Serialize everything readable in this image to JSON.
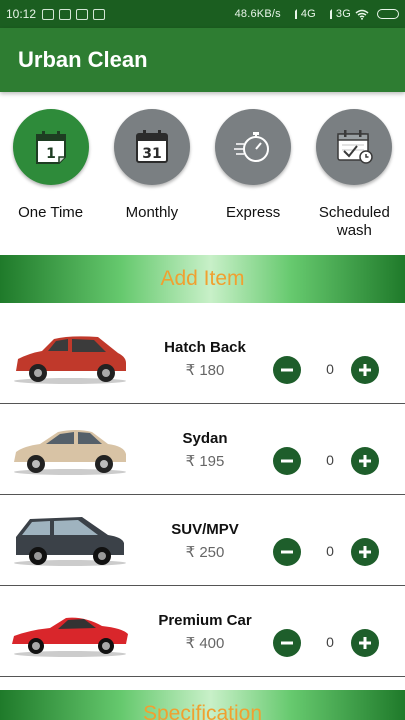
{
  "status_bar": {
    "time": "10:12",
    "network_text": "48.6KB/s",
    "signal_1": "4G",
    "signal_2": "3G"
  },
  "app_bar": {
    "title": "Urban Clean"
  },
  "plans": [
    {
      "label": "One Time",
      "icon": "calendar-1-icon",
      "selected": true
    },
    {
      "label": "Monthly",
      "icon": "calendar-31-icon",
      "day": "31",
      "selected": false
    },
    {
      "label": "Express",
      "icon": "stopwatch-icon",
      "selected": false
    },
    {
      "label": "Scheduled\nwash",
      "icon": "calendar-check-icon",
      "selected": false
    }
  ],
  "plan_day_one": "1",
  "sections": {
    "add_item": "Add Item",
    "specification": "Specification"
  },
  "colors": {
    "primary": "#2e7d32",
    "status": "#1b5e20",
    "accent_text": "#f0a030",
    "button": "#1e5e2b",
    "plan_inactive": "#7a7f82",
    "plan_active": "#2e8b3a"
  },
  "items": [
    {
      "name": "Hatch Back",
      "price": "₹ 180",
      "qty": "0",
      "car_color": "#c0392b",
      "icon": "hatchback-car-icon"
    },
    {
      "name": "Sydan",
      "price": "₹ 195",
      "qty": "0",
      "car_color": "#d8c3a5",
      "icon": "sedan-car-icon"
    },
    {
      "name": "SUV/MPV",
      "price": "₹ 250",
      "qty": "0",
      "car_color": "#3b4148",
      "icon": "suv-car-icon"
    },
    {
      "name": "Premium Car",
      "price": "₹ 400",
      "qty": "0",
      "car_color": "#d9262b",
      "icon": "sports-car-icon"
    }
  ]
}
